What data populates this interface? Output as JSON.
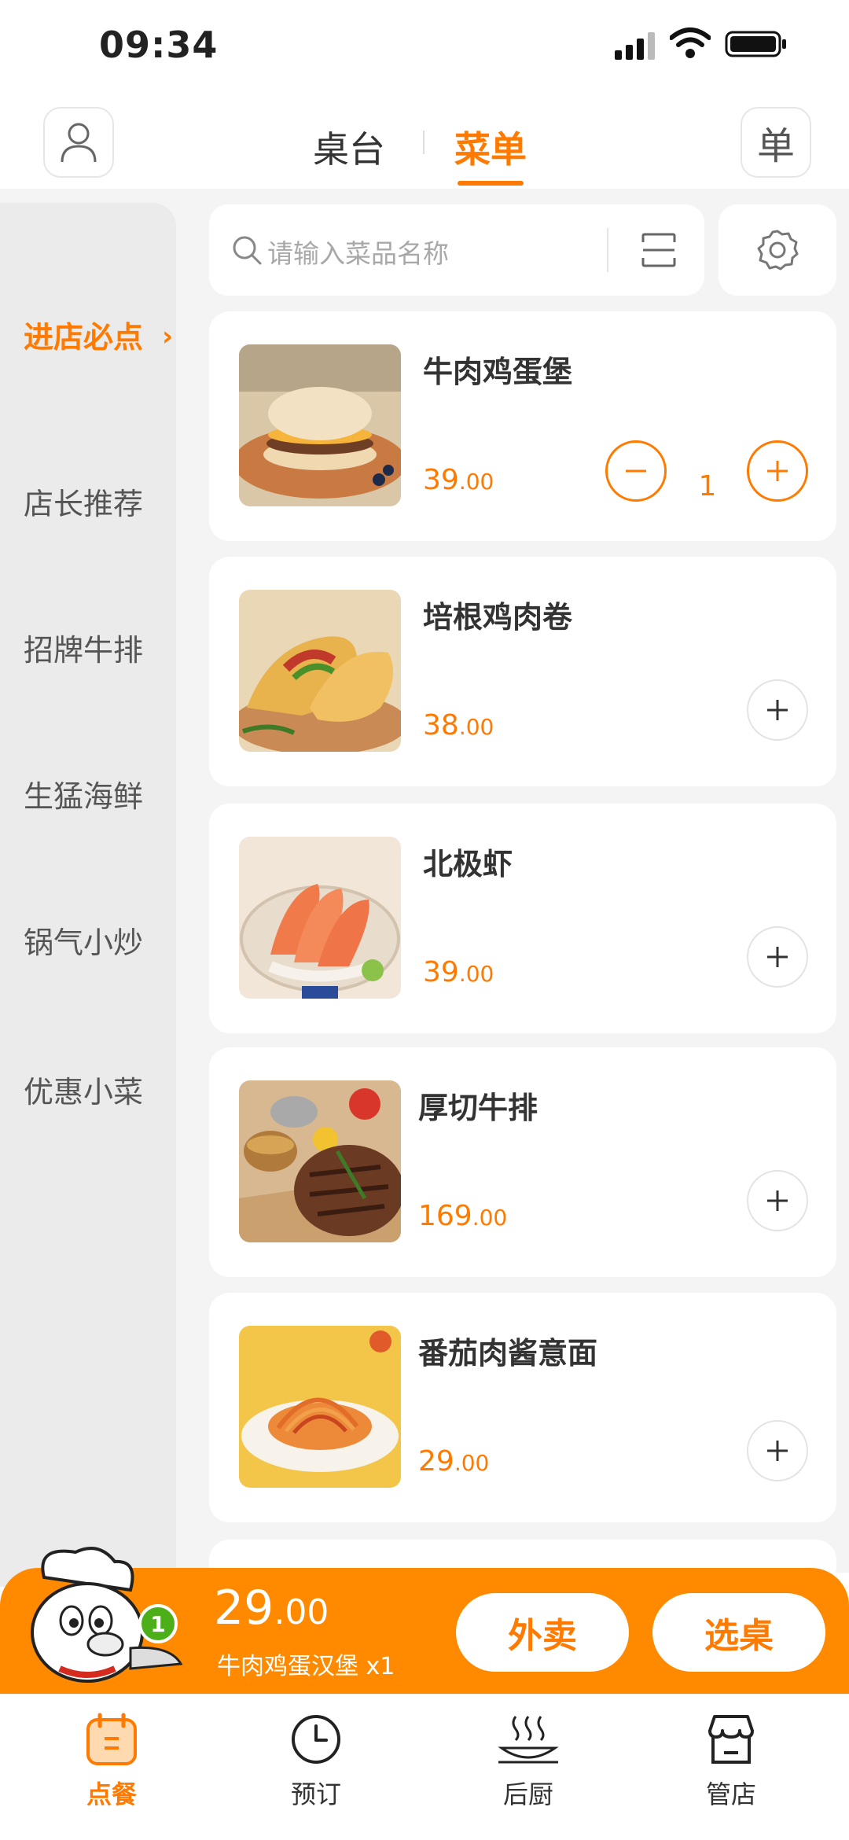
{
  "status_bar": {
    "time": "09:34"
  },
  "header": {
    "user_icon": "user-icon",
    "tabs": [
      {
        "label": "桌台",
        "active": false
      },
      {
        "label": "菜单",
        "active": true
      }
    ],
    "order_button_label": "单"
  },
  "search": {
    "placeholder": "请输入菜品名称",
    "scan_icon": "scan-icon",
    "settings_icon": "gear-icon"
  },
  "sidebar": {
    "categories": [
      {
        "label": "进店必点",
        "active": true
      },
      {
        "label": "店长推荐",
        "active": false
      },
      {
        "label": "招牌牛排",
        "active": false
      },
      {
        "label": "生猛海鲜",
        "active": false
      },
      {
        "label": "锅气小炒",
        "active": false
      },
      {
        "label": "优惠小菜",
        "active": false
      }
    ],
    "active_arrow": "›"
  },
  "dishes": [
    {
      "name": "牛肉鸡蛋堡",
      "price_int": "39",
      "price_dec": ".00",
      "quantity": "1"
    },
    {
      "name": "培根鸡肉卷",
      "price_int": "38",
      "price_dec": ".00"
    },
    {
      "name": "北极虾",
      "price_int": "39",
      "price_dec": ".00"
    },
    {
      "name": "厚切牛排",
      "price_int": "169",
      "price_dec": ".00"
    },
    {
      "name": "番茄肉酱意面",
      "price_int": "29",
      "price_dec": ".00"
    }
  ],
  "cart": {
    "count": "1",
    "total_int": "29",
    "total_dec": ".00",
    "items_text": "牛肉鸡蛋汉堡  x1",
    "takeout_label": "外卖",
    "choose_table_label": "选桌"
  },
  "bottom_nav": [
    {
      "label": "点餐",
      "icon": "calendar-icon",
      "active": true
    },
    {
      "label": "预订",
      "icon": "clock-icon",
      "active": false
    },
    {
      "label": "后厨",
      "icon": "dish-icon",
      "active": false
    },
    {
      "label": "管店",
      "icon": "store-icon",
      "active": false
    }
  ],
  "colors": {
    "accent": "#ff7a00",
    "cart_bar": "#ff8a00",
    "badge": "#4caf1a",
    "sidebar_bg": "#ebebeb",
    "page_bg": "#f4f4f4"
  }
}
